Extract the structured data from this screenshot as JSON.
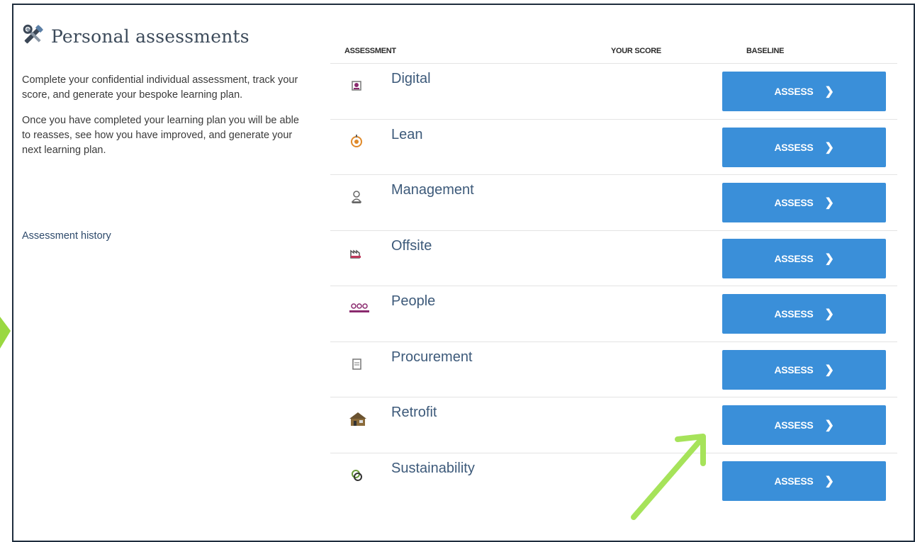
{
  "header": {
    "title": "Personal assessments",
    "icon": "tools-icon"
  },
  "intro": {
    "paragraph1": "Complete your confidential individual assessment, track your score, and generate your bespoke learning plan.",
    "paragraph2": "Once you have completed your learning plan you will be able to reasses, see how you have improved, and generate your next learning plan."
  },
  "history_link": "Assessment history",
  "table": {
    "columns": [
      "ASSESSMENT",
      "YOUR SCORE",
      "BASELINE"
    ],
    "button_label": "ASSESS",
    "button_chevron": "❯",
    "rows": [
      {
        "name": "Digital",
        "icon": "digital-icon"
      },
      {
        "name": "Lean",
        "icon": "lean-icon"
      },
      {
        "name": "Management",
        "icon": "management-icon"
      },
      {
        "name": "Offsite",
        "icon": "offsite-icon"
      },
      {
        "name": "People",
        "icon": "people-icon"
      },
      {
        "name": "Procurement",
        "icon": "procurement-icon"
      },
      {
        "name": "Retrofit",
        "icon": "retrofit-icon"
      },
      {
        "name": "Sustainability",
        "icon": "sustainability-icon"
      }
    ]
  },
  "colors": {
    "button": "#3a8fd9",
    "link": "#3d5a7a",
    "annotation_arrow": "#a6e35a"
  }
}
